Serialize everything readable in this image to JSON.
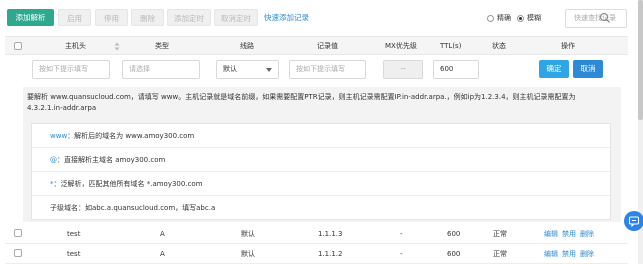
{
  "toolbar": {
    "add_record": "添加解析",
    "enable": "启用",
    "pause": "停用",
    "delete": "删除",
    "add_schedule": "添加定时",
    "cancel_schedule": "取消定时",
    "quick_add": "快速添加记录"
  },
  "search": {
    "mode_exact": "精确",
    "mode_fuzzy": "模糊",
    "selected_mode": "模糊",
    "placeholder": "快速查找记录"
  },
  "table": {
    "headers": [
      "主机头",
      "类型",
      "线路",
      "记录值",
      "MX优先级",
      "TTL(s)",
      "状态",
      "操作"
    ]
  },
  "new_record": {
    "host_placeholder": "按如下提示填写",
    "type_placeholder": "请选择",
    "line_value": "默认",
    "value_placeholder": "按如下提示填写",
    "mx_value": "--",
    "ttl_value": "600",
    "confirm": "确定",
    "cancel": "取消"
  },
  "help": {
    "intro": "要解析 www.quansucloud.com，请填写 www。主机记录就是域名前缀，如果需要配置PTR记录，则主机记录需配置IP.in-addr.arpa.，例如ip为1.2.3.4，则主机记录需配置为4.3.2.1.in-addr.arpa",
    "tips": [
      {
        "key": "www",
        "text": "：解析后的域名为 www.amoy300.com"
      },
      {
        "key": "@",
        "text": "：直接解析主域名 amoy300.com"
      },
      {
        "key": "*",
        "text": "：泛解析，匹配其他所有域名 *.amoy300.com"
      },
      {
        "key": "",
        "text": "子级域名：如abc.a.quansucloud.com，填写abc.a"
      }
    ]
  },
  "records": [
    {
      "host": "test",
      "type": "A",
      "line": "默认",
      "value": "1.1.1.3",
      "mx": "-",
      "ttl": "600",
      "status": "正常",
      "ops": [
        "编辑",
        "禁用",
        "删除"
      ]
    },
    {
      "host": "test",
      "type": "A",
      "line": "默认",
      "value": "1.1.1.2",
      "mx": "-",
      "ttl": "600",
      "status": "正常",
      "ops": [
        "编辑",
        "禁用",
        "删除"
      ]
    }
  ],
  "icons": {
    "search": "search-icon",
    "sort": "sort-icon",
    "select_arrow": "chevron-down-icon",
    "chat": "chat-icon"
  },
  "colors": {
    "primary_green": "#2ea98f",
    "link_blue": "#2c8ad6",
    "confirm_blue": "#2ea6e6"
  }
}
